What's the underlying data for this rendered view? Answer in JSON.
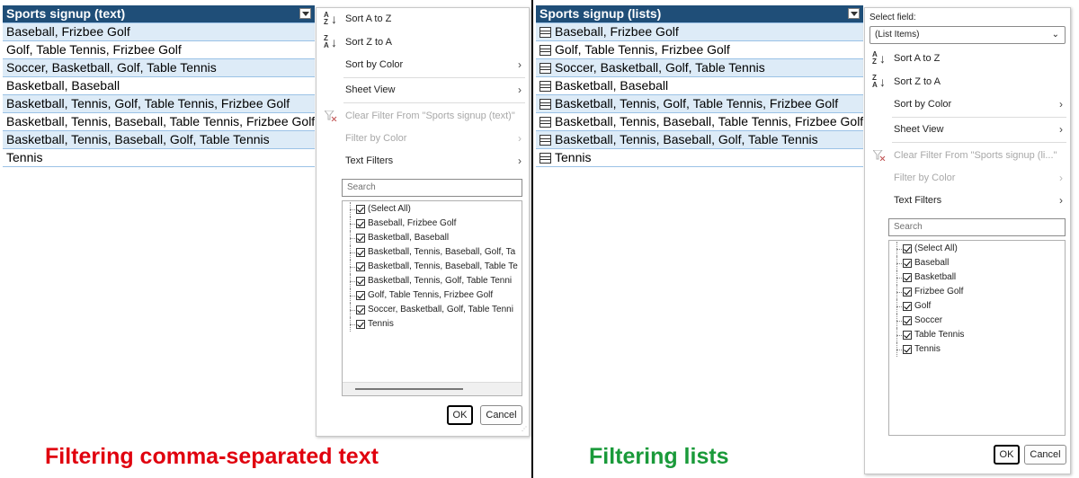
{
  "left": {
    "table": {
      "header": "Sports signup (text)",
      "rows": [
        "Baseball, Frizbee Golf",
        "Golf, Table Tennis, Frizbee Golf",
        "Soccer, Basketball, Golf, Table Tennis",
        "Basketball, Baseball",
        "Basketball, Tennis, Golf, Table Tennis, Frizbee Golf",
        "Basketball, Tennis, Baseball, Table Tennis, Frizbee Golf",
        "Basketball, Tennis, Baseball, Golf, Table Tennis",
        "Tennis"
      ]
    },
    "menu": {
      "sort_az": "Sort A to Z",
      "sort_za": "Sort Z to A",
      "sort_by_color": "Sort by Color",
      "sheet_view": "Sheet View",
      "clear_filter": "Clear Filter From \"Sports signup (text)\"",
      "filter_by_color": "Filter by Color",
      "text_filters": "Text Filters",
      "search_placeholder": "Search",
      "items": [
        "(Select All)",
        "Baseball, Frizbee Golf",
        "Basketball, Baseball",
        "Basketball, Tennis, Baseball, Golf, Ta",
        "Basketball, Tennis, Baseball, Table Te",
        "Basketball, Tennis, Golf, Table Tenni",
        "Golf, Table Tennis, Frizbee Golf",
        "Soccer, Basketball, Golf, Table Tenni",
        "Tennis"
      ],
      "ok": "OK",
      "cancel": "Cancel"
    },
    "caption": "Filtering comma-separated text",
    "caption_color": "#e0000e"
  },
  "right": {
    "table": {
      "header": "Sports signup (lists)",
      "rows": [
        "Baseball, Frizbee Golf",
        "Golf, Table Tennis, Frizbee Golf",
        "Soccer, Basketball, Golf, Table Tennis",
        "Basketball, Baseball",
        "Basketball, Tennis, Golf, Table Tennis, Frizbee Golf",
        "Basketball, Tennis, Baseball, Table Tennis, Frizbee Golf",
        "Basketball, Tennis, Baseball, Golf, Table Tennis",
        "Tennis"
      ]
    },
    "menu": {
      "select_field_label": "Select field:",
      "select_field_value": "(List Items)",
      "sort_az": "Sort A to Z",
      "sort_za": "Sort Z to A",
      "sort_by_color": "Sort by Color",
      "sheet_view": "Sheet View",
      "clear_filter": "Clear Filter From \"Sports signup (li...\"",
      "filter_by_color": "Filter by Color",
      "text_filters": "Text Filters",
      "search_placeholder": "Search",
      "items": [
        "(Select All)",
        "Baseball",
        "Basketball",
        "Frizbee Golf",
        "Golf",
        "Soccer",
        "Table Tennis",
        "Tennis"
      ],
      "ok": "OK",
      "cancel": "Cancel"
    },
    "caption": "Filtering lists",
    "caption_color": "#1a9a3a"
  },
  "colors": {
    "header_bg": "#1f4e78",
    "band_bg": "#ddebf7"
  },
  "icons": [
    "dropdown-arrow-icon",
    "sort-az-icon",
    "sort-za-icon",
    "clear-filter-icon",
    "chevron-right-icon",
    "checkbox-checked-icon",
    "list-row-icon"
  ]
}
